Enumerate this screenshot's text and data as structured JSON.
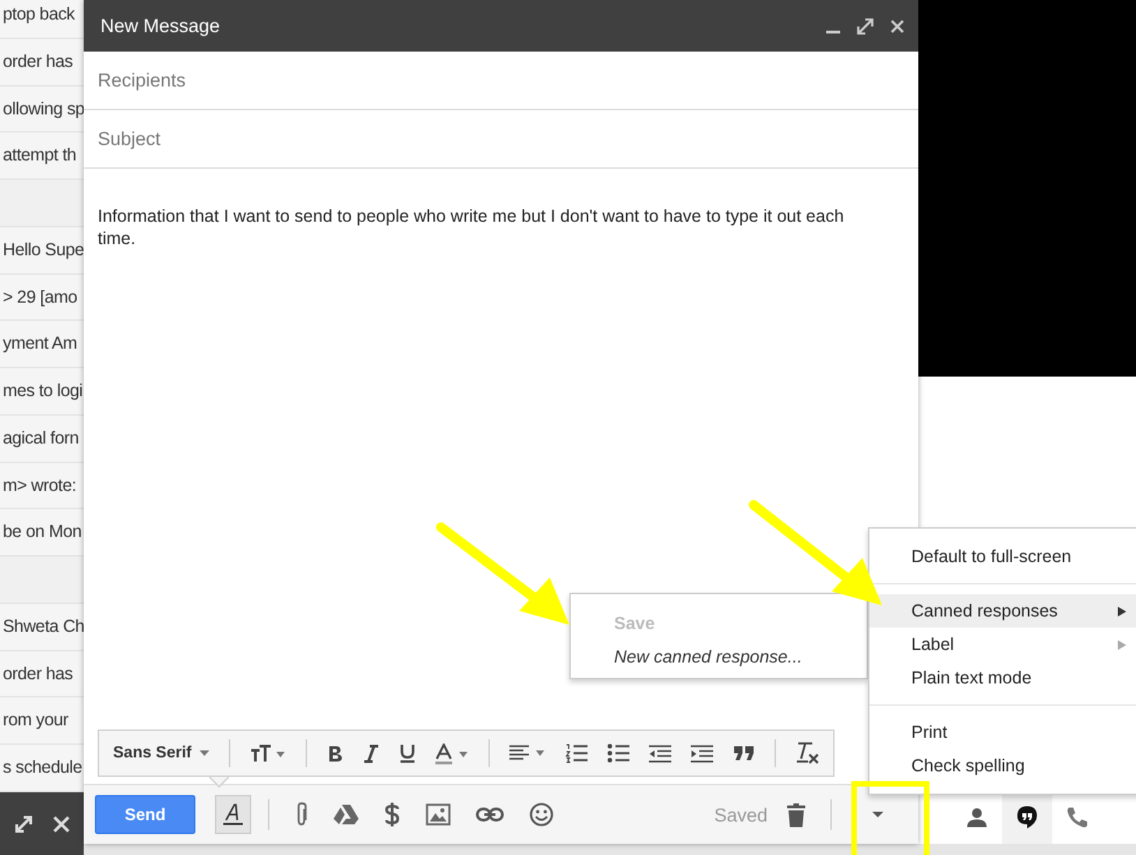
{
  "background_list": {
    "rows": [
      {
        "kind": "message",
        "text": "ptop back"
      },
      {
        "kind": "message",
        "text": "order has"
      },
      {
        "kind": "message",
        "text": "ollowing sp"
      },
      {
        "kind": "message",
        "text": "attempt th"
      },
      {
        "kind": "blank"
      },
      {
        "kind": "message",
        "text": "Hello Supe"
      },
      {
        "kind": "message",
        "text": "> 29 [amo"
      },
      {
        "kind": "message",
        "text": "yment Am"
      },
      {
        "kind": "message",
        "text": "mes to logi"
      },
      {
        "kind": "message",
        "text": "agical forn"
      },
      {
        "kind": "message",
        "text": "m> wrote:"
      },
      {
        "kind": "message",
        "text": "be on Mon"
      },
      {
        "kind": "blank"
      },
      {
        "kind": "message",
        "text": "Shweta Ch"
      },
      {
        "kind": "message",
        "text": "order has"
      },
      {
        "kind": "message",
        "text": "rom your"
      },
      {
        "kind": "message",
        "text": "s schedule"
      }
    ]
  },
  "compose": {
    "title": "New Message",
    "recipients": {
      "placeholder": "Recipients"
    },
    "subject": {
      "placeholder": "Subject"
    },
    "body": "Information that I want to send to people who write me but I don't want to have to type it out each time.",
    "format_toolbar": {
      "font": "Sans Serif"
    },
    "send": "Send",
    "status": "Saved"
  },
  "more_menu": {
    "items": [
      {
        "kind": "item",
        "label": "Default to full-screen",
        "selected": false,
        "submenu": false
      },
      {
        "kind": "divider"
      },
      {
        "kind": "item",
        "label": "Canned responses",
        "selected": true,
        "submenu": true
      },
      {
        "kind": "item",
        "label": "Label",
        "selected": false,
        "submenu": true
      },
      {
        "kind": "item",
        "label": "Plain text mode",
        "selected": false,
        "submenu": false
      },
      {
        "kind": "divider"
      },
      {
        "kind": "item",
        "label": "Print",
        "selected": false,
        "submenu": false
      },
      {
        "kind": "item",
        "label": "Check spelling",
        "selected": false,
        "submenu": false
      }
    ]
  },
  "canned_submenu": {
    "items": [
      {
        "kind": "heading",
        "label": "Save"
      },
      {
        "kind": "action",
        "label": "New canned response..."
      }
    ]
  },
  "side_panel": {
    "tabs": [
      {
        "kind": "contacts",
        "selected": false
      },
      {
        "kind": "hangouts",
        "selected": true
      },
      {
        "kind": "phone",
        "selected": false
      }
    ]
  }
}
